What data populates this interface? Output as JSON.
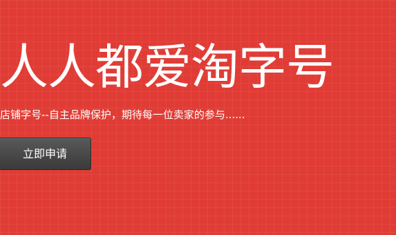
{
  "hero": {
    "title": "人人都爱淘字号",
    "subtitle": "店铺字号--自主品牌保护，期待每一位卖家的参与......",
    "apply_button_label": "立即申请"
  },
  "colors": {
    "background": "#e03c35",
    "button": "#4a4a4a",
    "text": "#ffffff"
  }
}
